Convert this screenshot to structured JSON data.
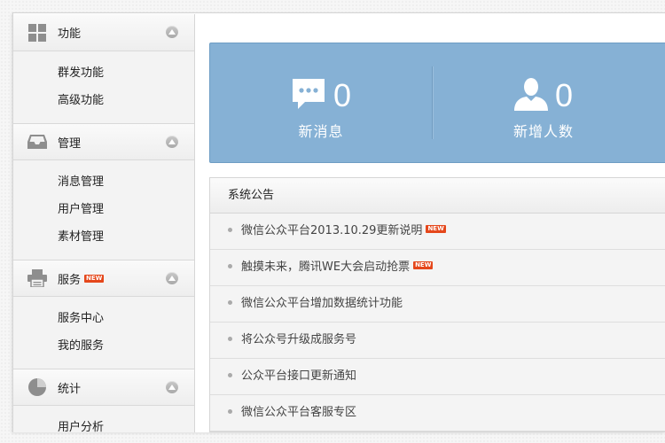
{
  "sidebar": {
    "sections": [
      {
        "title": "功能",
        "icon": "grid-icon",
        "new": "",
        "items": [
          "群发功能",
          "高级功能"
        ]
      },
      {
        "title": "管理",
        "icon": "inbox-icon",
        "new": "",
        "items": [
          "消息管理",
          "用户管理",
          "素材管理"
        ]
      },
      {
        "title": "服务",
        "icon": "printer-icon",
        "new": "NEW",
        "items": [
          "服务中心",
          "我的服务"
        ]
      },
      {
        "title": "统计",
        "icon": "pie-chart-icon",
        "new": "",
        "items": [
          "用户分析"
        ]
      }
    ]
  },
  "stats": {
    "messages": {
      "count": "0",
      "label": "新消息",
      "icon": "chat-bubble-icon"
    },
    "users": {
      "count": "0",
      "label": "新增人数",
      "icon": "user-icon"
    }
  },
  "notice": {
    "title": "系统公告",
    "items": [
      {
        "text": "微信公众平台2013.10.29更新说明",
        "new": "NEW"
      },
      {
        "text": "触摸未来，腾讯WE大会启动抢票",
        "new": "NEW"
      },
      {
        "text": "微信公众平台增加数据统计功能",
        "new": ""
      },
      {
        "text": "将公众号升级成服务号",
        "new": ""
      },
      {
        "text": "公众平台接口更新通知",
        "new": ""
      },
      {
        "text": "微信公众平台客服专区",
        "new": ""
      }
    ]
  },
  "colors": {
    "stats_bg": "#86b1d5",
    "new_badge": "#e5471b",
    "sidebar_bg": "#f3f3f3"
  }
}
